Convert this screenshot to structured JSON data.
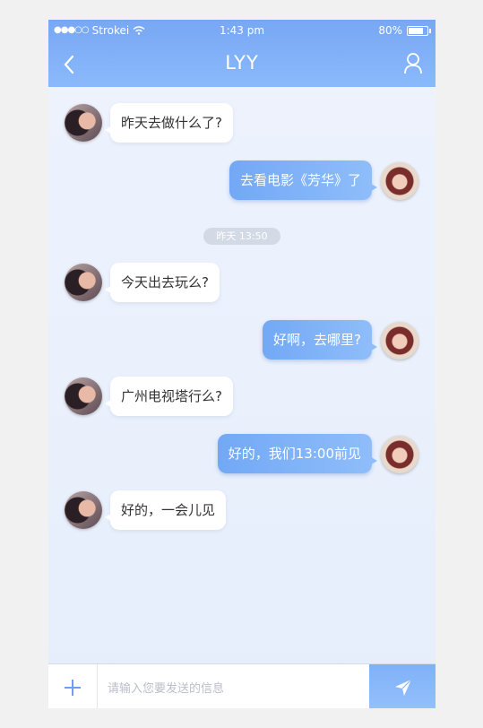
{
  "status_bar": {
    "signal_dots": "●●●○○",
    "carrier": "Strokei",
    "time": "1:43 pm",
    "battery": "80%",
    "battery_level": 0.8
  },
  "header": {
    "title": "LYY",
    "back_icon": "chevron-left-icon",
    "profile_icon": "user-icon"
  },
  "messages": [
    {
      "from": "other",
      "text": "昨天去做什么了?"
    },
    {
      "from": "me",
      "text": "去看电影《芳华》了"
    },
    {
      "from": "other",
      "text": "今天出去玩么?"
    },
    {
      "from": "me",
      "text": "好啊，去哪里?"
    },
    {
      "from": "other",
      "text": "广州电视塔行么?"
    },
    {
      "from": "me",
      "text": "好的，我们13:00前见"
    },
    {
      "from": "other",
      "text": "好的，一会儿见"
    }
  ],
  "timestamp": "昨天 13:50",
  "composer": {
    "placeholder": "请输入您要发送的信息",
    "add_icon": "plus-icon",
    "send_icon": "send-icon"
  },
  "colors": {
    "header_gradient_start": "#78a7f4",
    "header_gradient_end": "#8ab9fb",
    "my_bubble": "#7aaef6",
    "background": "#eaf1fd"
  }
}
